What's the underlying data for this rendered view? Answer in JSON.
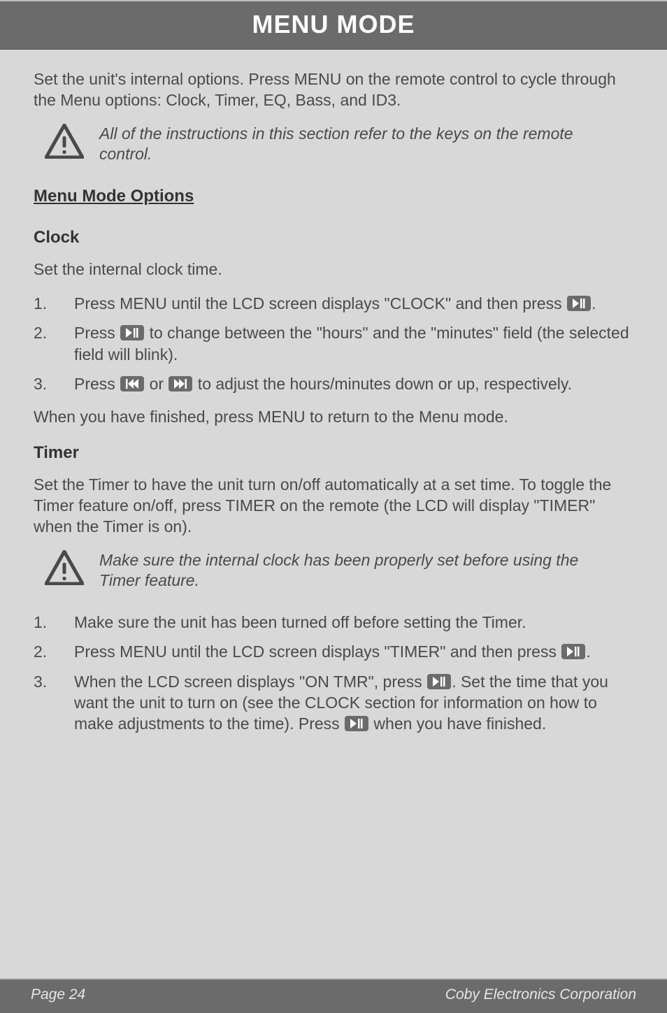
{
  "header": {
    "title": "MENU MODE"
  },
  "intro": "Set the unit's internal options. Press MENU on the remote control to cycle through the Menu options: Clock, Timer, EQ, Bass, and ID3.",
  "note1": "All of the instructions in this section refer to the keys on the remote control.",
  "section_title": "Menu Mode Options",
  "clock": {
    "title": "Clock",
    "desc": "Set the internal clock time.",
    "steps": {
      "s1_num": "1.",
      "s1_a": "Press MENU until the LCD screen displays \"CLOCK\" and then press ",
      "s1_b": ".",
      "s2_num": "2.",
      "s2_a": "Press ",
      "s2_b": " to change between the \"hours\" and the \"minutes\" field (the selected field will blink).",
      "s3_num": "3.",
      "s3_a": "Press ",
      "s3_b": " or ",
      "s3_c": " to adjust the hours/minutes down or up, respectively."
    },
    "after": "When you have finished, press MENU to return to the Menu mode."
  },
  "timer": {
    "title": "Timer",
    "desc": "Set the Timer to have the unit turn on/off automatically at a set time. To toggle the Timer feature on/off, press TIMER on the remote (the LCD will display \"TIMER\" when the Timer is on).",
    "note": "Make sure the internal clock has been properly set before using the Timer feature.",
    "steps": {
      "s1_num": "1.",
      "s1": "Make sure the unit has been turned off before setting the Timer.",
      "s2_num": "2.",
      "s2_a": "Press MENU until the LCD screen displays \"TIMER\" and then press ",
      "s2_b": ".",
      "s3_num": "3.",
      "s3_a": "When the LCD screen displays \"ON TMR\", press ",
      "s3_b": ". Set the time that you want the unit to turn on (see the CLOCK section for information on how to make adjustments to the time). Press ",
      "s3_c": " when you have finished."
    }
  },
  "footer": {
    "page": "Page 24",
    "corp": "Coby Electronics Corporation"
  },
  "icons": {
    "play_pause": "play-pause-icon",
    "prev": "skip-prev-icon",
    "next": "skip-next-icon",
    "warning": "warning-icon"
  }
}
